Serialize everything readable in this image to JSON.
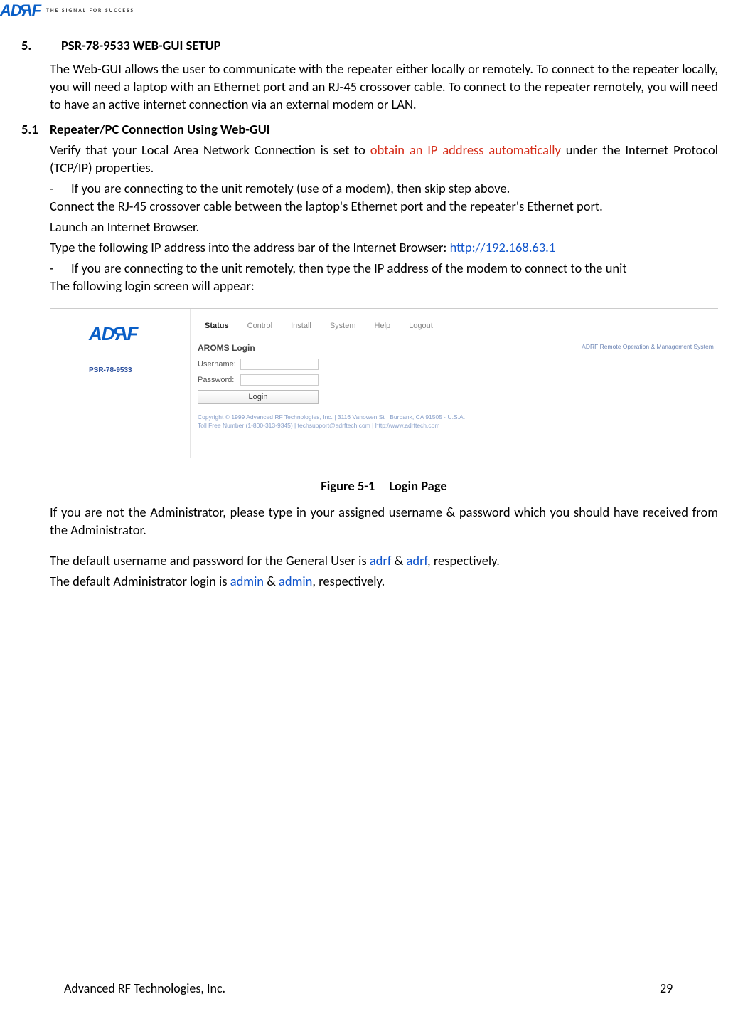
{
  "header": {
    "logo_text": "ADRF",
    "tagline": "THE SIGNAL FOR SUCCESS"
  },
  "section5": {
    "number": "5.",
    "title": "PSR-78-9533 WEB-GUI SETUP",
    "intro": "The Web-GUI allows the user to communicate with the repeater either locally or remotely.  To connect to the repeater locally, you will need a laptop with an Ethernet port and an RJ-45 crossover cable.  To connect to the repeater remotely, you will need to have an active internet connection via an external modem or LAN."
  },
  "section51": {
    "number": "5.1",
    "title": "Repeater/PC Connection Using Web-GUI",
    "verify_pre": "Verify that your Local Area Network Connection is set to ",
    "verify_red": "obtain an IP address automatically",
    "verify_post": " under the Internet Protocol (TCP/IP) properties.",
    "dash1": "If you are connecting to the unit remotely (use of a modem), then skip step above.",
    "connect": "Connect the RJ-45 crossover cable between the laptop's Ethernet port and the repeater's Ethernet port.",
    "launch": "Launch an Internet Browser.",
    "type_pre": "Type the following IP address into the address bar of the Internet Browser: ",
    "type_link": "http://192.168.63.1",
    "dash2": "If you are connecting to the unit remotely, then type the IP address of the modem to connect to the unit",
    "login_will": "The following login screen will appear:"
  },
  "screenshot": {
    "side_model": "PSR-78-9533",
    "tabs": [
      "Status",
      "Control",
      "Install",
      "System",
      "Help",
      "Logout"
    ],
    "form_title": "AROMS Login",
    "lbl_user": "Username:",
    "lbl_pass": "Password:",
    "btn_login": "Login",
    "copy1": "Copyright © 1999 Advanced RF Technologies, Inc. | 3116 Vanowen St · Burbank, CA 91505 · U.S.A.",
    "copy2": "Toll Free Number (1-800-313-9345) | techsupport@adrftech.com | http://www.adrftech.com",
    "right_text": "ADRF Remote Operation & Management System"
  },
  "figure": {
    "label": "Figure 5-1",
    "title": "Login Page"
  },
  "post": {
    "p1": "If you are not the Administrator, please type in your assigned username & password which you should have received from the Administrator.",
    "p2_pre": "The default username and password for the General User is ",
    "p2_u": "adrf",
    "p2_mid": " & ",
    "p2_p": "adrf",
    "p2_post": ", respectively.",
    "p3_pre": "The default Administrator login is ",
    "p3_u": "admin",
    "p3_mid": " & ",
    "p3_p": "admin",
    "p3_post": ", respectively."
  },
  "footer": {
    "company": "Advanced RF Technologies, Inc.",
    "page": "29"
  }
}
